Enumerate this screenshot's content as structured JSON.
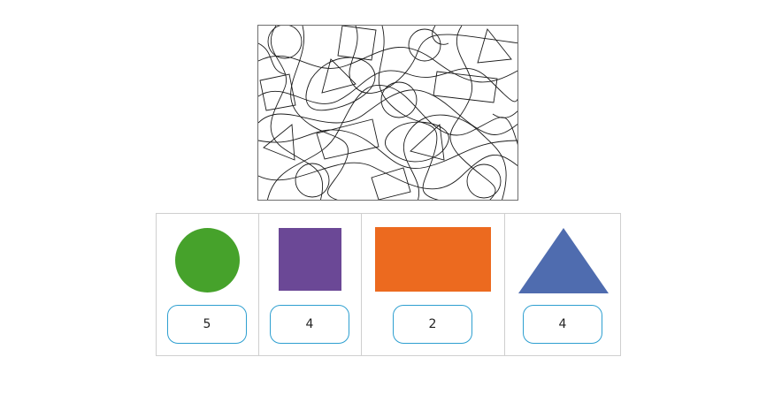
{
  "shapes": [
    {
      "kind": "circle",
      "color": "#46a22b",
      "answer": "5"
    },
    {
      "kind": "square",
      "color": "#6b4896",
      "answer": "4"
    },
    {
      "kind": "rectangle",
      "color": "#ec6a1f",
      "answer": "2"
    },
    {
      "kind": "triangle",
      "color": "#4f6caf",
      "answer": "4"
    }
  ],
  "input_border_color": "#2e9fd0"
}
